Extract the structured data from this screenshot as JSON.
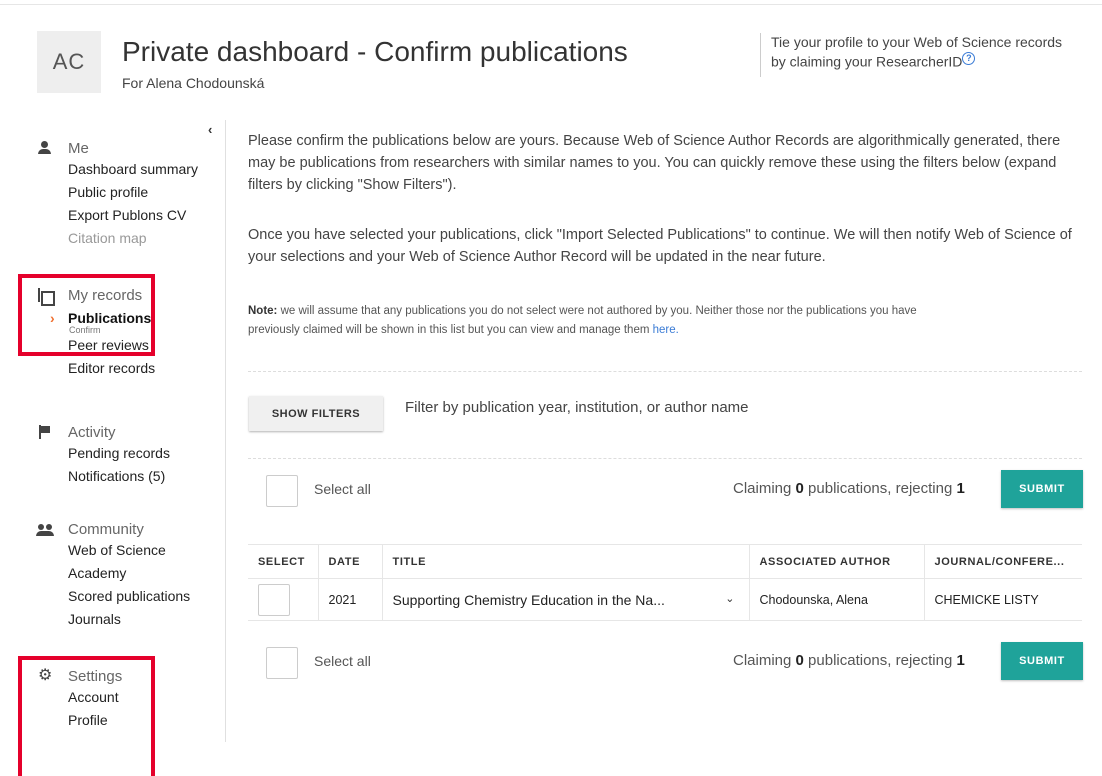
{
  "header": {
    "avatar_initials": "AC",
    "title": "Private dashboard - Confirm publications",
    "subtitle": "For Alena Chodounská",
    "claim_text": "Tie your profile to your Web of Science records by claiming your ResearcherID"
  },
  "sidebar": {
    "me": {
      "label": "Me",
      "links": [
        "Dashboard summary",
        "Public profile",
        "Export Publons CV",
        "Citation map"
      ]
    },
    "my_records": {
      "label": "My records",
      "active_link": "Publications",
      "active_sub": "Confirm",
      "links": [
        "Peer reviews",
        "Editor records"
      ]
    },
    "activity": {
      "label": "Activity",
      "links": [
        "Pending records",
        "Notifications (5)"
      ]
    },
    "community": {
      "label": "Community",
      "links": [
        "Web of Science",
        "Academy",
        "Scored publications",
        "Journals"
      ]
    },
    "settings": {
      "label": "Settings",
      "links": [
        "Account",
        "Profile"
      ]
    }
  },
  "main": {
    "intro": "Please confirm the publications below are yours. Because Web of Science Author Records are algorithmically generated, there may be publications from researchers with similar names to you. You can quickly remove these using the filters below (expand filters by clicking \"Show Filters\").",
    "intro2": "Once you have selected your publications, click \"Import Selected Publications\" to continue. We will then notify Web of Science of your selections and your Web of Science Author Record will be updated in the near future.",
    "note_label": "Note:",
    "note_text": "we will assume that any publications you do not select were not authored by you. Neither those nor the publications you have previously claimed will be shown in this list but you can view and manage them",
    "note_link": "here.",
    "show_filters_label": "SHOW FILTERS",
    "filter_hint": "Filter by publication year, institution, or author name",
    "select_all_label": "Select all",
    "claiming_prefix": "Claiming",
    "claiming_count": "0",
    "rejecting_prefix": "publications, rejecting",
    "rejecting_count": "1",
    "submit_label": "SUBMIT"
  },
  "table": {
    "columns": [
      "SELECT",
      "DATE",
      "TITLE",
      "ASSOCIATED AUTHOR",
      "JOURNAL/CONFERE..."
    ],
    "rows": [
      {
        "date": "2021",
        "title": "Supporting Chemistry Education in the Na...",
        "author": "Chodounska, Alena",
        "journal": "CHEMICKE LISTY"
      }
    ]
  },
  "colors": {
    "accent": "#1fa39a",
    "highlight": "#e5002b",
    "active_chevron": "#f07030",
    "link": "#3a7bd5"
  }
}
